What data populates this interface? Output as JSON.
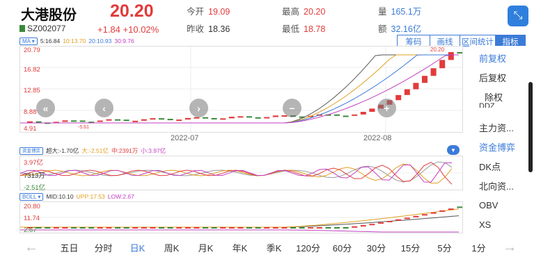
{
  "stock": {
    "name": "大港股份",
    "code": "SZ002077",
    "price": "20.20",
    "change": "+1.84",
    "change_pct": "+10.02%"
  },
  "stats": {
    "open_label": "今开",
    "open": "19.09",
    "prev_close_label": "昨收",
    "prev_close": "18.36",
    "high_label": "最高",
    "high": "20.20",
    "low_label": "最低",
    "low": "18.78",
    "volume_label": "量",
    "volume": "165.1万",
    "amount_label": "额",
    "amount": "32.16亿"
  },
  "ma": {
    "button": "MA",
    "ma5": "5:16.84",
    "ma10": "10:13.70",
    "ma20": "20:10.93",
    "ma30": "30:9.76"
  },
  "tool_tabs": [
    "筹码",
    "画线",
    "区间统计",
    "指标"
  ],
  "main_chart": {
    "y_labels": [
      "20.79",
      "16.82",
      "12.85",
      "8.88",
      "4.91"
    ],
    "x_labels": [
      "2022-07",
      "2022-08"
    ],
    "peak_label": "20.20",
    "low_label": "-5.61"
  },
  "side_menu": [
    "前复权",
    "后复权",
    "除权",
    "DDZ",
    "主力资...",
    "资金博弈",
    "DK点",
    "北向资...",
    "OBV",
    "XS"
  ],
  "fund_panel": {
    "button": "资金博弈",
    "super": "超大:-1.70亿",
    "big": "大:-2.51亿",
    "mid": "中:2391万",
    "small": "小:3.97亿",
    "y_labels": [
      "3.97亿",
      "7313万",
      "-2.51亿"
    ]
  },
  "boll_panel": {
    "button": "BOLL",
    "mid": "MID:10.10",
    "upp": "UPP:17.53",
    "low": "LOW:2.67",
    "y_labels": [
      "20.80",
      "11.74",
      "2.67"
    ]
  },
  "bottom_tabs": [
    "五日",
    "分时",
    "日K",
    "周K",
    "月K",
    "年K",
    "季K",
    "120分",
    "60分",
    "30分",
    "15分",
    "5分",
    "1分"
  ],
  "colors": {
    "up": "#e23b3b",
    "down": "#3a8a3a",
    "accent": "#3b7bd8"
  }
}
